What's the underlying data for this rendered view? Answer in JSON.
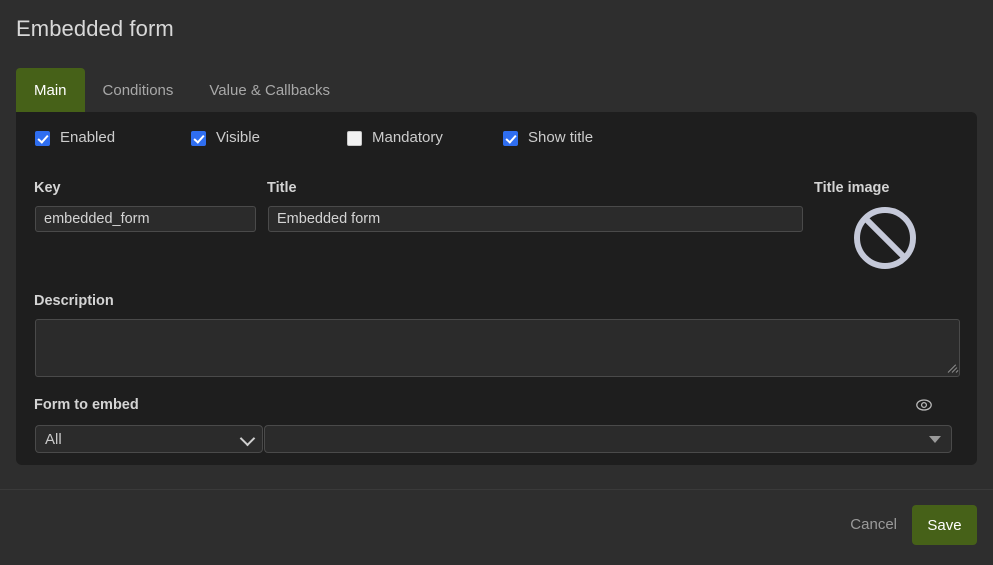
{
  "header": {
    "title": "Embedded form"
  },
  "tabs": [
    {
      "label": "Main",
      "active": true
    },
    {
      "label": "Conditions",
      "active": false
    },
    {
      "label": "Value & Callbacks",
      "active": false
    }
  ],
  "checkboxes": [
    {
      "label": "Enabled",
      "checked": true
    },
    {
      "label": "Visible",
      "checked": true
    },
    {
      "label": "Mandatory",
      "checked": false
    },
    {
      "label": "Show title",
      "checked": true
    }
  ],
  "fields": {
    "key": {
      "label": "Key",
      "value": "embedded_form",
      "placeholder": ""
    },
    "title": {
      "label": "Title",
      "value": "Embedded form",
      "placeholder": ""
    },
    "title_image": {
      "label": "Title image",
      "icon": "no-image-icon"
    },
    "description": {
      "label": "Description",
      "value": "",
      "placeholder": ""
    },
    "form_to_embed": {
      "label": "Form to embed",
      "preview_icon": "eye-icon",
      "scope_select": {
        "value": "All",
        "options": [
          "All"
        ]
      },
      "form_select": {
        "value": "",
        "options": []
      }
    }
  },
  "footer": {
    "cancel_label": "Cancel",
    "save_label": "Save"
  },
  "colors": {
    "accent_green": "#466118",
    "checkbox_blue": "#2f6ef0",
    "page_bg": "#2e2e2e",
    "panel_bg": "#1e1e1e",
    "input_bg": "#2b2b2b",
    "icon_gray": "#c5c9d9"
  }
}
